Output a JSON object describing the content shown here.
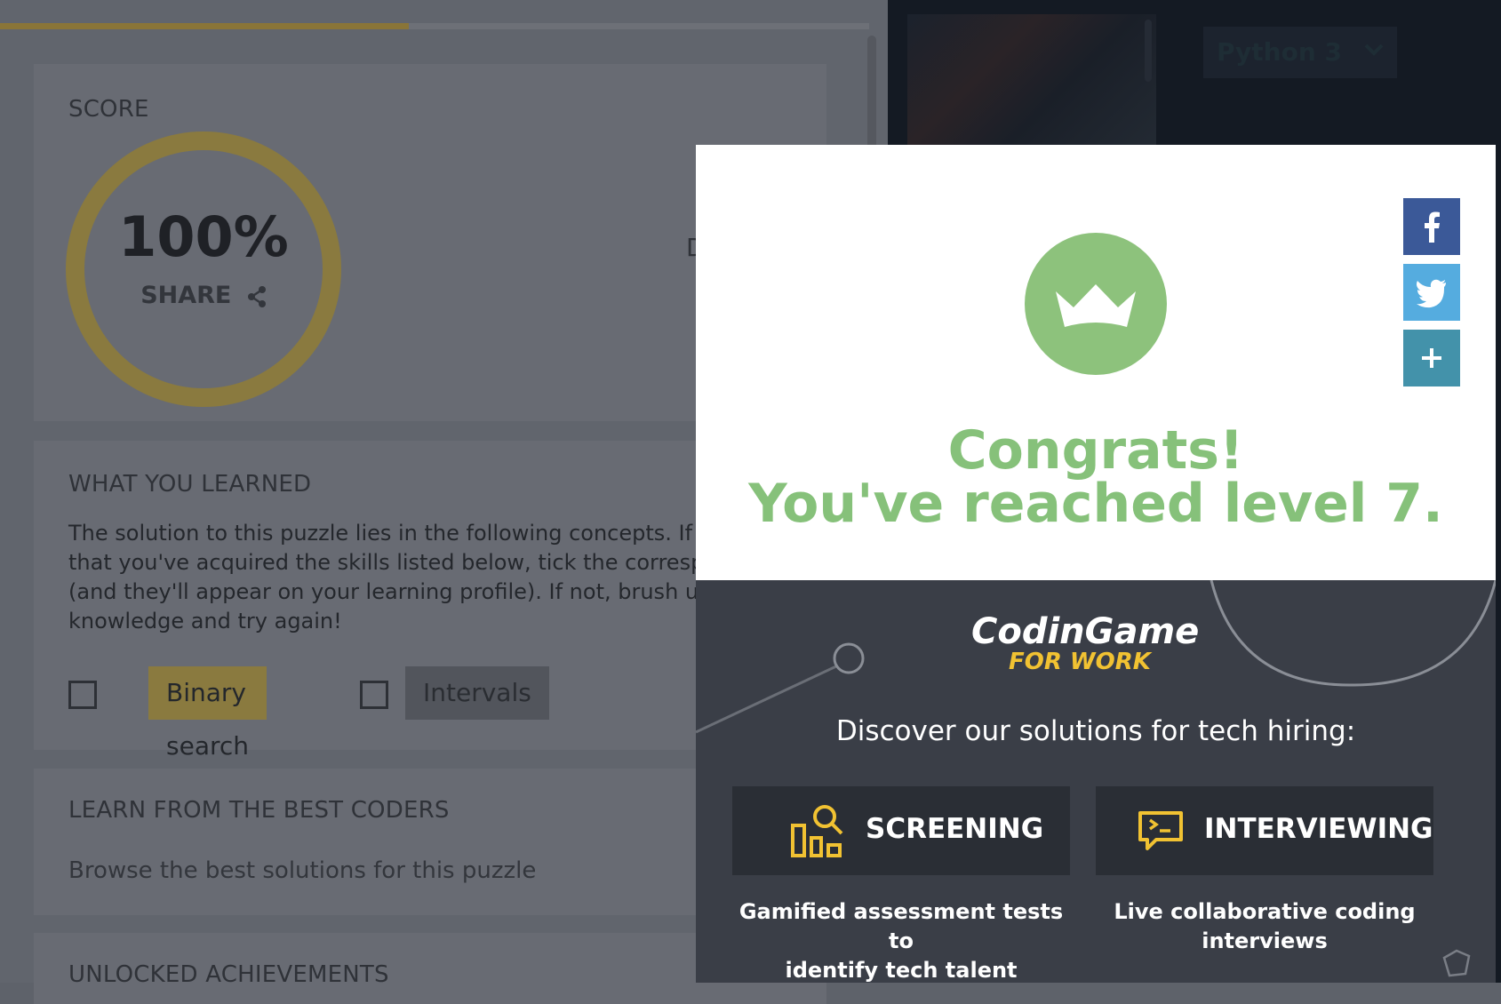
{
  "progress": {
    "fraction": 0.47
  },
  "score": {
    "title": "SCORE",
    "value": "100%",
    "share_label": "SHARE",
    "cut_text": "D"
  },
  "learned": {
    "title": "WHAT YOU LEARNED",
    "lines": [
      "The solution to this puzzle lies in the following concepts. If you c",
      "that you've acquired the skills listed below, tick the correspondi",
      "(and they'll appear on your learning profile). If not, brush up on",
      "knowledge and try again!"
    ],
    "concepts": [
      "Binary search",
      "Intervals"
    ]
  },
  "best": {
    "title": "LEARN FROM THE BEST CODERS",
    "text": "Browse the best solutions for this puzzle"
  },
  "achievements": {
    "title": "UNLOCKED ACHIEVEMENTS"
  },
  "editor": {
    "language": "Python 3"
  },
  "modal": {
    "congrats_line1": "Congrats!",
    "congrats_line2": "You've reached level 7.",
    "social": [
      "facebook-icon",
      "twitter-icon",
      "plus-icon"
    ],
    "brand_name": "CodinGame",
    "brand_sub": "FOR WORK",
    "discover": "Discover our solutions for tech hiring:",
    "solutions": [
      {
        "label": "SCREENING",
        "desc_line1": "Gamified assessment tests to",
        "desc_line2": "identify tech talent"
      },
      {
        "label": "INTERVIEWING",
        "desc_line1": "Live collaborative coding",
        "desc_line2": "interviews"
      }
    ]
  },
  "colors": {
    "accent_yellow": "#f1c232",
    "congrats_green": "#86c17a",
    "facebook": "#3b5998",
    "twitter": "#55acdf",
    "share_plus": "#4392aa"
  }
}
